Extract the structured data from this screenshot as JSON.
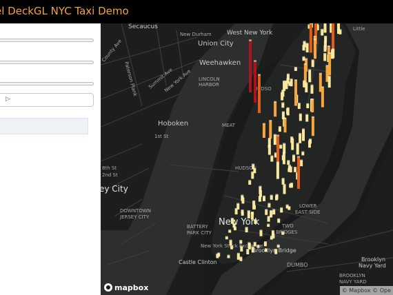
{
  "header": {
    "title": "el DeckGL NYC Taxi Demo"
  },
  "sidebar": {
    "play_icon": "▷"
  },
  "map": {
    "labels": {
      "secaucus": "Secaucus",
      "new_durham": "New Durham",
      "west_new_york": "West New York",
      "union_city": "Union City",
      "weehawken": "Weehawken",
      "lincoln_harbor_1": "LINCOLN",
      "lincoln_harbor_2": "HARBOR",
      "hoboken": "Hoboken",
      "jersey_city": "ey City",
      "downtown_jersey_city_1": "DOWNTOWN",
      "downtown_jersey_city_2": "JERSEY CITY",
      "new_york": "New York",
      "battery_park_1": "BATTERY",
      "battery_park_2": "PARK CITY",
      "new_york_exchange": "New York Stock Exchange",
      "castle_clinton": "Castle Clinton",
      "two_bridges_1": "TWO",
      "two_bridges_2": "BRIDGES",
      "brooklyn_bridge": "Brooklyn Bridge",
      "dumbo": "DUMBO",
      "lower_east_side_1": "LOWER",
      "lower_east_side_2": "EAST SIDE",
      "brooklyn_navy_yard_1": "Brooklyn",
      "brooklyn_navy_yard_2": "Navy Yard",
      "brooklyn_navy_yard_3": "BROOKLYN",
      "brooklyn_navy_yard_4": "NAVY YARD",
      "little_ferry": "Little",
      "meatpacking": "MEAT",
      "hudson": "HUDSO",
      "hudson_sq": "HUDSON",
      "first_st": "1st St",
      "eighth_st": "8th St",
      "county_ave": "County Ave",
      "paterson_plank": "Paterson Plank",
      "summit_ave": "Summit Ave",
      "new_york_ave": "New York Ave",
      "second_st": "2nd St"
    },
    "attribution": "© Mapbox © Ope",
    "logo_text": "mapbox"
  },
  "colors": {
    "accent": "#f2a33b",
    "map_bg": "#191a1a",
    "column_low": "#f7e89c",
    "column_mid": "#f6a63c",
    "column_high": "#e35d1a",
    "column_peak": "#b0121b"
  }
}
